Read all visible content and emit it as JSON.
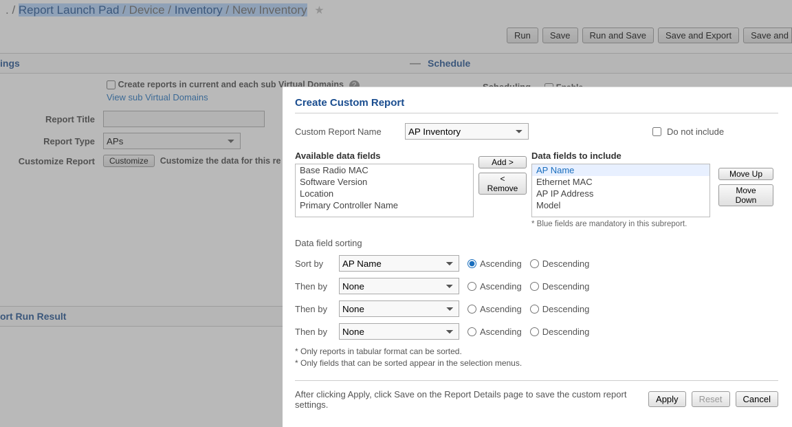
{
  "breadcrumb": {
    "prefix": ". / ",
    "links": [
      "Report Launch Pad",
      "Device",
      "Inventory"
    ],
    "current": "New Inventory"
  },
  "topButtons": {
    "run": "Run",
    "save": "Save",
    "runSave": "Run and Save",
    "saveExport": "Save and Export",
    "saveEmail": "Save and"
  },
  "sections": {
    "settings": "ings",
    "schedule": "Schedule",
    "result": "ort Run Result"
  },
  "settingsForm": {
    "createSubLabel": "Create reports in current and each sub Virtual Domains",
    "viewSubLink": "View sub Virtual Domains",
    "reportTitle": "Report Title",
    "reportType": "Report Type",
    "reportTypeValue": "APs",
    "customize": "Customize Report",
    "customizeBtn": "Customize",
    "customizeHint": "Customize the data for this re"
  },
  "schedule": {
    "scheduling": "Scheduling",
    "enable": "Enable"
  },
  "modal": {
    "title": "Create Custom Report",
    "nameLabel": "Custom Report Name",
    "nameValue": "AP Inventory",
    "doNotInclude": "Do not include",
    "availLabel": "Available data fields",
    "inclLabel": "Data fields to include",
    "available": [
      "Base Radio MAC",
      "Software Version",
      "Location",
      "Primary Controller Name"
    ],
    "included": [
      "AP Name",
      "Ethernet MAC",
      "AP IP Address",
      "Model"
    ],
    "addBtn": "Add >",
    "removeBtn": "< Remove",
    "moveUp": "Move Up",
    "moveDown": "Move Down",
    "blueNote": "* Blue fields are mandatory in this subreport.",
    "sortTitle": "Data field sorting",
    "sortBy": "Sort by",
    "thenBy": "Then by",
    "sortValue": "AP Name",
    "noneValue": "None",
    "asc": "Ascending",
    "desc": "Descending",
    "note1": "* Only reports in tabular format can be sorted.",
    "note2": "* Only fields that can be sorted appear in the selection menus.",
    "footerMsg": "After clicking Apply, click Save on the Report Details page to save the custom report settings.",
    "apply": "Apply",
    "reset": "Reset",
    "cancel": "Cancel"
  }
}
